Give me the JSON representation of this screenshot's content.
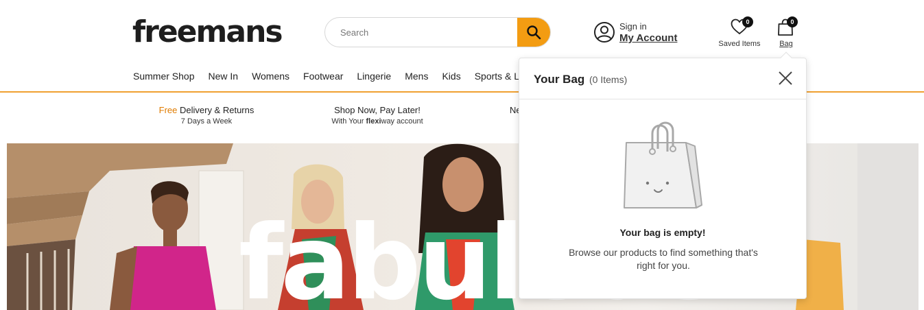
{
  "brand": {
    "logo_text": "freemans",
    "accent_color": "#f39c12"
  },
  "search": {
    "placeholder": "Search",
    "button_icon": "search-icon"
  },
  "account": {
    "signin": "Sign in",
    "my_account": "My Account",
    "icon": "user-circle-icon"
  },
  "saved": {
    "label": "Saved Items",
    "count": "0",
    "icon": "heart-icon"
  },
  "bag": {
    "label": "Bag",
    "count": "0",
    "icon": "shopping-bag-icon"
  },
  "nav": {
    "items": [
      {
        "label": "Summer Shop"
      },
      {
        "label": "New In"
      },
      {
        "label": "Womens"
      },
      {
        "label": "Footwear"
      },
      {
        "label": "Lingerie"
      },
      {
        "label": "Mens"
      },
      {
        "label": "Kids"
      },
      {
        "label": "Sports & Le"
      }
    ]
  },
  "promos": [
    {
      "highlight": "Free",
      "title": "Delivery & Returns",
      "subtitle": "7 Days a Week"
    },
    {
      "title": "Shop Now, Pay Later!",
      "subtitle_pre": "With Your ",
      "subtitle_bold": "flexi",
      "subtitle_post": "way account"
    },
    {
      "title": "Ne"
    }
  ],
  "hero": {
    "headline": "fabulous"
  },
  "bag_panel": {
    "title": "Your Bag",
    "count_text": "(0 Items)",
    "empty_title": "Your bag is empty!",
    "empty_message": "Browse our products to find something that's right for you.",
    "close_icon": "close-icon",
    "illustration": "empty-bag-illustration"
  }
}
